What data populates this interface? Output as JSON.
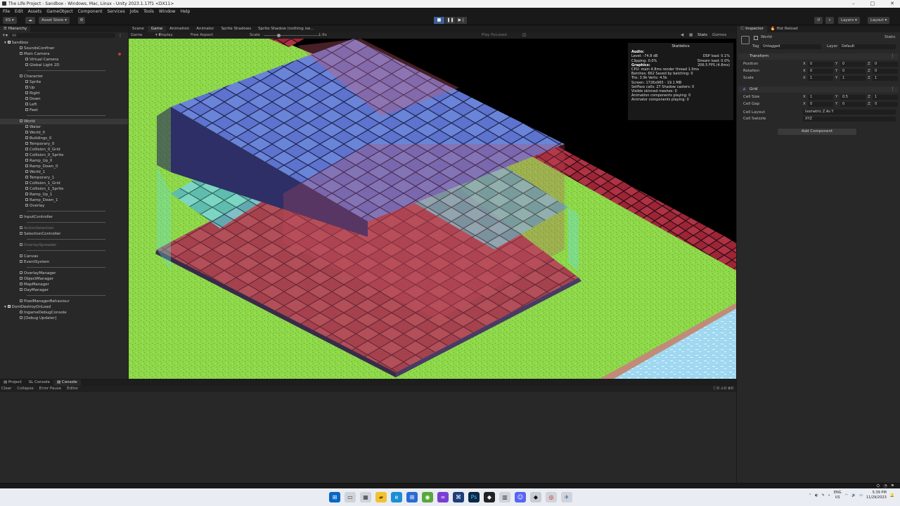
{
  "window": {
    "title": "The Life Project - Sandbox - Windows, Mac, Linux - Unity 2023.1.17f1 <DX11>",
    "buttons": [
      "–",
      "□",
      "✕"
    ]
  },
  "menu": [
    "File",
    "Edit",
    "Assets",
    "GameObject",
    "Component",
    "Services",
    "Jobs",
    "Tools",
    "Window",
    "Help"
  ],
  "toolbar": {
    "account": "KS",
    "asset_store": "Asset Store",
    "layers": "Layers",
    "layout": "Layout"
  },
  "hierarchy": {
    "tab": "Hierarchy",
    "search_placeholder": "All",
    "items": [
      {
        "label": "Sandbox",
        "depth": 0,
        "kind": "scene"
      },
      {
        "label": "SoundsConfiner",
        "depth": 1
      },
      {
        "label": "Main Camera",
        "depth": 1
      },
      {
        "label": "Virtual Camera",
        "depth": 2
      },
      {
        "label": "Global Light 2D",
        "depth": 2
      },
      {
        "label": "",
        "depth": 1,
        "kind": "sep"
      },
      {
        "label": "Character",
        "depth": 1
      },
      {
        "label": "Sprite",
        "depth": 2
      },
      {
        "label": "Up",
        "depth": 2
      },
      {
        "label": "Right",
        "depth": 2
      },
      {
        "label": "Down",
        "depth": 2
      },
      {
        "label": "Left",
        "depth": 2
      },
      {
        "label": "Feet",
        "depth": 2
      },
      {
        "label": "",
        "depth": 1,
        "kind": "sep"
      },
      {
        "label": "World",
        "depth": 1,
        "kind": "sel"
      },
      {
        "label": "Water",
        "depth": 2
      },
      {
        "label": "World_0",
        "depth": 2
      },
      {
        "label": "Buildings_0",
        "depth": 2
      },
      {
        "label": "Temporary_0",
        "depth": 2
      },
      {
        "label": "Collision_0_Grid",
        "depth": 2
      },
      {
        "label": "Collision_0_Sprite",
        "depth": 2
      },
      {
        "label": "Ramp_Up_0",
        "depth": 2
      },
      {
        "label": "Ramp_Down_0",
        "depth": 2
      },
      {
        "label": "World_1",
        "depth": 2
      },
      {
        "label": "Temporary_1",
        "depth": 2
      },
      {
        "label": "Collision_1_Grid",
        "depth": 2
      },
      {
        "label": "Collision_1_Sprite",
        "depth": 2
      },
      {
        "label": "Ramp_Up_1",
        "depth": 2
      },
      {
        "label": "Ramp_Down_1",
        "depth": 2
      },
      {
        "label": "Overlay",
        "depth": 2
      },
      {
        "label": "",
        "depth": 1,
        "kind": "sep"
      },
      {
        "label": "InputController",
        "depth": 1
      },
      {
        "label": "",
        "depth": 1,
        "kind": "sep"
      },
      {
        "label": "ActionSelection",
        "depth": 1,
        "kind": "dim"
      },
      {
        "label": "SelectionController",
        "depth": 1
      },
      {
        "label": "",
        "depth": 1,
        "kind": "sep"
      },
      {
        "label": "OverlaySpreader",
        "depth": 1,
        "kind": "dim"
      },
      {
        "label": "",
        "depth": 1,
        "kind": "sep"
      },
      {
        "label": "Canvas",
        "depth": 1
      },
      {
        "label": "EventSystem",
        "depth": 1
      },
      {
        "label": "",
        "depth": 1,
        "kind": "sep"
      },
      {
        "label": "OverlayManager",
        "depth": 1
      },
      {
        "label": "ObjectManager",
        "depth": 1
      },
      {
        "label": "MapManager",
        "depth": 1
      },
      {
        "label": "DayManager",
        "depth": 1
      },
      {
        "label": "",
        "depth": 1,
        "kind": "sep"
      },
      {
        "label": "PixelManagerBehaviour",
        "depth": 1
      },
      {
        "label": "DontDestroyOnLoad",
        "depth": 0,
        "kind": "scene"
      },
      {
        "label": "IngameDebugConsole",
        "depth": 1
      },
      {
        "label": "[Debug Updater]",
        "depth": 1
      }
    ]
  },
  "game": {
    "tabs": [
      "Scene",
      "Game",
      "Animation",
      "Animator",
      "Sprite Shadows",
      "Sprite Shadow (nothing ise..."
    ],
    "active_tab": "Game",
    "bar": {
      "mode": "Game",
      "display": "Display 1",
      "aspect": "Free Aspect",
      "scale_label": "Scale",
      "scale_value": "1.6x",
      "play_focused": "Play Focused",
      "stats": "Stats",
      "gizmos": "Gizmos"
    }
  },
  "stats": {
    "title": "Statistics",
    "audio_header": "Audio:",
    "level": "Level: -74.8 dB",
    "clipping": "Clipping: 0.0%",
    "dsp": "DSP load: 0.1%",
    "stream": "Stream load: 0.0%",
    "graphics_header": "Graphics:",
    "fps": "206.5 FPS (4.8ms)",
    "cpu": "CPU: main 4.8ms  render thread 1.0ms",
    "batches": "Batches: 662   Saved by batching: 0",
    "tris": "Tris: 3.9k  Verts: 4.5k",
    "screen": "Screen: 1726x965 - 19.1 MB",
    "setpass": "SetPass calls: 27    Shadow casters: 0",
    "skinned": "Visible skinned meshes: 0",
    "anim": "Animation components playing: 0",
    "animator": "Animator components playing: 0"
  },
  "inspector": {
    "tabs": [
      "Inspector",
      "Hot Reload"
    ],
    "object_name": "World",
    "static_label": "Static",
    "tag_label": "Tag",
    "tag_value": "Untagged",
    "layer_label": "Layer",
    "layer_value": "Default",
    "transform": {
      "title": "Transform",
      "rows": [
        {
          "label": "Position",
          "x": "0",
          "y": "0",
          "z": "0"
        },
        {
          "label": "Rotation",
          "x": "0",
          "y": "0",
          "z": "0"
        },
        {
          "label": "Scale",
          "x": "1",
          "y": "1",
          "z": "1"
        }
      ]
    },
    "grid": {
      "title": "Grid",
      "rows": [
        {
          "label": "Cell Size",
          "x": "1",
          "y": "0.5",
          "z": "1"
        },
        {
          "label": "Cell Gap",
          "x": "0",
          "y": "0",
          "z": "0"
        }
      ],
      "layout_label": "Cell Layout",
      "layout_value": "Isometric Z As Y",
      "swizzle_label": "Cell Swizzle",
      "swizzle_value": "XYZ"
    },
    "add_component": "Add Component"
  },
  "console": {
    "tabs": [
      "Project",
      "Console",
      "Console"
    ],
    "buttons": [
      "Clear",
      "Collapse",
      "Error Pause",
      "Editor"
    ],
    "counts": [
      "0",
      "0",
      "0"
    ]
  },
  "taskbar": {
    "lang_top": "ENG",
    "lang_bottom": "US",
    "time": "5:39 PM",
    "date": "11/29/2023"
  }
}
